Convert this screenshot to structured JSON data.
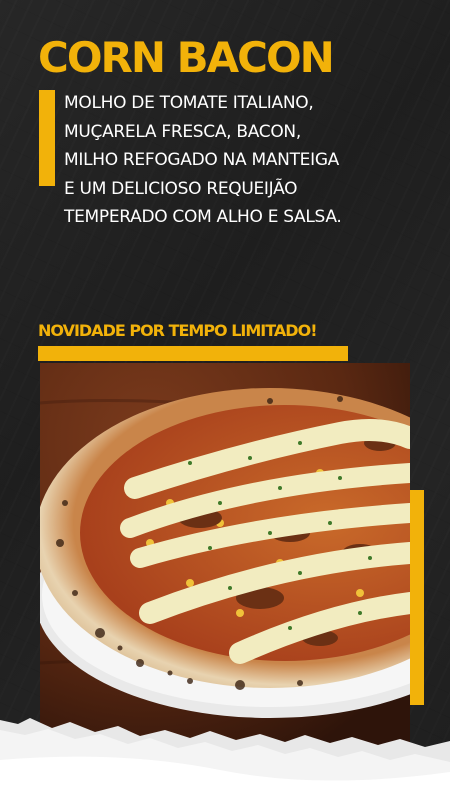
{
  "title": "CORN BACON",
  "description_lines": [
    "MOLHO DE TOMATE ITALIANO,",
    "MUÇARELA FRESCA, BACON,",
    "MILHO REFOGADO NA MANTEIGA",
    "E UM DELICIOSO REQUEIJÃO",
    "TEMPERADO COM ALHO E SALSA."
  ],
  "promo": "NOVIDADE POR TEMPO LIMITADO!",
  "colors": {
    "accent": "#f2b20a",
    "background": "#202020",
    "text": "#ffffff"
  },
  "image": "corn-bacon-pizza-photo"
}
